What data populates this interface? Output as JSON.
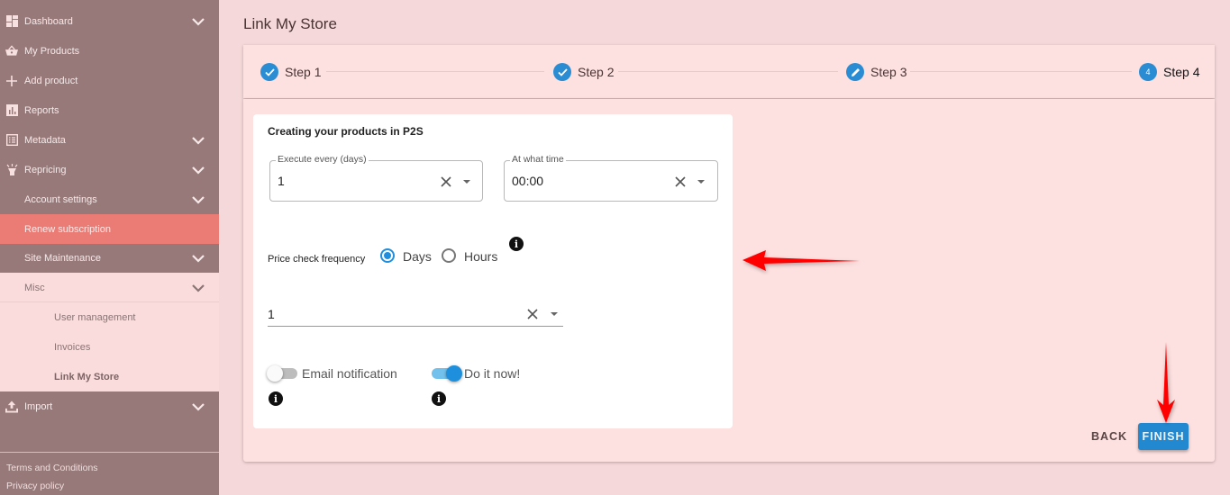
{
  "sidebar": {
    "items": [
      {
        "label": "Dashboard",
        "icon": "dashboard-icon",
        "expandable": true
      },
      {
        "label": "My Products",
        "icon": "basket-icon",
        "expandable": false
      },
      {
        "label": "Add product",
        "icon": "plus-icon",
        "expandable": false
      },
      {
        "label": "Reports",
        "icon": "bar-chart-icon",
        "expandable": false
      },
      {
        "label": "Metadata",
        "icon": "list-icon",
        "expandable": true
      },
      {
        "label": "Repricing",
        "icon": "lamp-icon",
        "expandable": true
      },
      {
        "label": "Account settings",
        "expandable": true
      },
      {
        "label": "Renew subscription",
        "expandable": false,
        "highlighted": true
      },
      {
        "label": "Site Maintenance",
        "expandable": true
      },
      {
        "label": "Misc",
        "expandable": true,
        "expanded": true
      },
      {
        "label": "User management"
      },
      {
        "label": "Invoices"
      },
      {
        "label": "Link My Store",
        "active": true
      },
      {
        "label": "Import",
        "icon": "upload-icon",
        "expandable": true
      }
    ],
    "footer": {
      "terms": "Terms and Conditions",
      "privacy": "Privacy policy"
    }
  },
  "page": {
    "title": "Link My Store"
  },
  "stepper": {
    "steps": [
      {
        "label": "Step 1",
        "state": "completed",
        "icon": "check-icon"
      },
      {
        "label": "Step 2",
        "state": "completed",
        "icon": "check-icon"
      },
      {
        "label": "Step 3",
        "state": "editing",
        "icon": "pencil-icon"
      },
      {
        "label": "Step 4",
        "state": "current",
        "number": "4"
      }
    ]
  },
  "form": {
    "title": "Creating your products in P2S",
    "execute_every": {
      "label": "Execute every (days)",
      "value": "1"
    },
    "at_what_time": {
      "label": "At what time",
      "value": "00:00"
    },
    "price_check": {
      "label": "Price check frequency",
      "options": [
        {
          "label": "Days",
          "selected": true
        },
        {
          "label": "Hours",
          "selected": false
        }
      ],
      "value": "1"
    },
    "email_notification": {
      "label": "Email notification",
      "enabled": false
    },
    "do_it_now": {
      "label": "Do it now!",
      "enabled": true
    },
    "info_glyph": "i"
  },
  "actions": {
    "back": "BACK",
    "finish": "FINISH"
  },
  "colors": {
    "accent": "#2289d0",
    "sidebar": "#977979",
    "highlight": "#eb7b75",
    "annotation_arrow": "#ff0000"
  }
}
